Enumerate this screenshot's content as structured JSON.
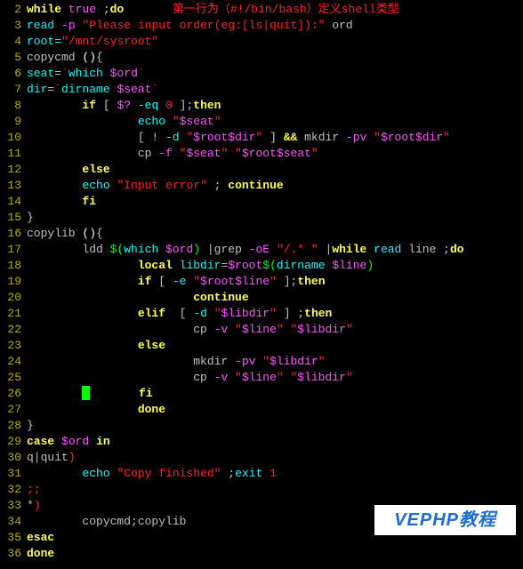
{
  "gutter_start": 2,
  "gutter_end": 36,
  "cursor_line": 26,
  "lines": [
    {
      "n": 2,
      "segs": [
        {
          "cls": "c-yellow",
          "t": "while "
        },
        {
          "cls": "c-magenta",
          "t": "true"
        },
        {
          "cls": "c-base",
          "t": " ;"
        },
        {
          "cls": "c-yellow",
          "t": "do"
        },
        {
          "cls": "c-red",
          "t": "       第一行为（#!/bin/bash）定义shell类型"
        }
      ]
    },
    {
      "n": 3,
      "segs": [
        {
          "cls": "c-cyan",
          "t": "read"
        },
        {
          "cls": "c-magenta",
          "t": " -p "
        },
        {
          "cls": "c-red",
          "t": "\"Please input order(eg:[ls|quit]):\""
        },
        {
          "cls": "c-base",
          "t": " ord"
        }
      ]
    },
    {
      "n": 4,
      "segs": [
        {
          "cls": "c-cyan",
          "t": "root="
        },
        {
          "cls": "c-red",
          "t": "\"/mnt/sysroot\""
        }
      ]
    },
    {
      "n": 5,
      "segs": [
        {
          "cls": "c-base",
          "t": "copycmd "
        },
        {
          "cls": "c-white",
          "t": "()"
        },
        {
          "cls": "c-base",
          "t": "{"
        }
      ]
    },
    {
      "n": 6,
      "segs": [
        {
          "cls": "c-cyan",
          "t": "seat"
        },
        {
          "cls": "c-base",
          "t": "="
        },
        {
          "cls": "c-red",
          "t": "`"
        },
        {
          "cls": "c-cyan",
          "t": "which"
        },
        {
          "cls": "c-red",
          "t": " "
        },
        {
          "cls": "c-magenta",
          "t": "$ord"
        },
        {
          "cls": "c-red",
          "t": "`"
        }
      ]
    },
    {
      "n": 7,
      "segs": [
        {
          "cls": "c-cyan",
          "t": "dir"
        },
        {
          "cls": "c-base",
          "t": "="
        },
        {
          "cls": "c-red",
          "t": "`"
        },
        {
          "cls": "c-cyan",
          "t": "dirname"
        },
        {
          "cls": "c-red",
          "t": " "
        },
        {
          "cls": "c-magenta",
          "t": "$seat"
        },
        {
          "cls": "c-red",
          "t": "`"
        }
      ]
    },
    {
      "n": 8,
      "segs": [
        {
          "cls": "c-base",
          "t": "        "
        },
        {
          "cls": "c-yellow",
          "t": "if"
        },
        {
          "cls": "c-base",
          "t": " [ "
        },
        {
          "cls": "c-magenta",
          "t": "$?"
        },
        {
          "cls": "c-cyan",
          "t": " -eq "
        },
        {
          "cls": "c-red",
          "t": "0"
        },
        {
          "cls": "c-base",
          "t": " ];"
        },
        {
          "cls": "c-yellow",
          "t": "then"
        }
      ]
    },
    {
      "n": 9,
      "segs": [
        {
          "cls": "c-base",
          "t": "                "
        },
        {
          "cls": "c-cyan",
          "t": "echo"
        },
        {
          "cls": "c-base",
          "t": " "
        },
        {
          "cls": "c-red",
          "t": "\""
        },
        {
          "cls": "c-magenta",
          "t": "$seat"
        },
        {
          "cls": "c-red",
          "t": "\""
        }
      ]
    },
    {
      "n": 10,
      "segs": [
        {
          "cls": "c-base",
          "t": "                [ ! "
        },
        {
          "cls": "c-cyan",
          "t": "-d"
        },
        {
          "cls": "c-base",
          "t": " "
        },
        {
          "cls": "c-red",
          "t": "\""
        },
        {
          "cls": "c-magenta",
          "t": "$root$dir"
        },
        {
          "cls": "c-red",
          "t": "\""
        },
        {
          "cls": "c-base",
          "t": " ] "
        },
        {
          "cls": "c-yellow",
          "t": "&&"
        },
        {
          "cls": "c-base",
          "t": " mkdir "
        },
        {
          "cls": "c-magenta",
          "t": "-pv "
        },
        {
          "cls": "c-red",
          "t": "\""
        },
        {
          "cls": "c-magenta",
          "t": "$root$dir"
        },
        {
          "cls": "c-red",
          "t": "\""
        }
      ]
    },
    {
      "n": 11,
      "segs": [
        {
          "cls": "c-base",
          "t": "                cp "
        },
        {
          "cls": "c-magenta",
          "t": "-f "
        },
        {
          "cls": "c-red",
          "t": "\""
        },
        {
          "cls": "c-magenta",
          "t": "$seat"
        },
        {
          "cls": "c-red",
          "t": "\" \""
        },
        {
          "cls": "c-magenta",
          "t": "$root$seat"
        },
        {
          "cls": "c-red",
          "t": "\""
        }
      ]
    },
    {
      "n": 12,
      "segs": [
        {
          "cls": "c-base",
          "t": "        "
        },
        {
          "cls": "c-yellow",
          "t": "else"
        }
      ]
    },
    {
      "n": 13,
      "segs": [
        {
          "cls": "c-base",
          "t": "        "
        },
        {
          "cls": "c-cyan",
          "t": "echo"
        },
        {
          "cls": "c-base",
          "t": " "
        },
        {
          "cls": "c-red",
          "t": "\"Input error\""
        },
        {
          "cls": "c-base",
          "t": " ; "
        },
        {
          "cls": "c-yellow",
          "t": "continue"
        }
      ]
    },
    {
      "n": 14,
      "segs": [
        {
          "cls": "c-base",
          "t": "        "
        },
        {
          "cls": "c-yellow",
          "t": "fi"
        }
      ]
    },
    {
      "n": 15,
      "segs": [
        {
          "cls": "c-base",
          "t": "}"
        }
      ]
    },
    {
      "n": 16,
      "segs": [
        {
          "cls": "c-base",
          "t": "copylib "
        },
        {
          "cls": "c-white",
          "t": "()"
        },
        {
          "cls": "c-base",
          "t": "{"
        }
      ]
    },
    {
      "n": 17,
      "segs": [
        {
          "cls": "c-base",
          "t": "        ldd "
        },
        {
          "cls": "c-lime",
          "t": "$("
        },
        {
          "cls": "c-cyan",
          "t": "which "
        },
        {
          "cls": "c-magenta",
          "t": "$ord"
        },
        {
          "cls": "c-lime",
          "t": ")"
        },
        {
          "cls": "c-base",
          "t": " |grep "
        },
        {
          "cls": "c-magenta",
          "t": "-oE "
        },
        {
          "cls": "c-red",
          "t": "\"/.* \""
        },
        {
          "cls": "c-base",
          "t": " |"
        },
        {
          "cls": "c-yellow",
          "t": "while"
        },
        {
          "cls": "c-base",
          "t": " "
        },
        {
          "cls": "c-cyan",
          "t": "read"
        },
        {
          "cls": "c-base",
          "t": " line ;"
        },
        {
          "cls": "c-yellow",
          "t": "do"
        }
      ]
    },
    {
      "n": 18,
      "segs": [
        {
          "cls": "c-base",
          "t": "                "
        },
        {
          "cls": "c-yellow",
          "t": "local"
        },
        {
          "cls": "c-base",
          "t": " "
        },
        {
          "cls": "c-cyan",
          "t": "libdir"
        },
        {
          "cls": "c-base",
          "t": "="
        },
        {
          "cls": "c-magenta",
          "t": "$root"
        },
        {
          "cls": "c-lime",
          "t": "$("
        },
        {
          "cls": "c-cyan",
          "t": "dirname "
        },
        {
          "cls": "c-magenta",
          "t": "$line"
        },
        {
          "cls": "c-lime",
          "t": ")"
        }
      ]
    },
    {
      "n": 19,
      "segs": [
        {
          "cls": "c-base",
          "t": "                "
        },
        {
          "cls": "c-yellow",
          "t": "if"
        },
        {
          "cls": "c-base",
          "t": " [ "
        },
        {
          "cls": "c-cyan",
          "t": "-e"
        },
        {
          "cls": "c-base",
          "t": " "
        },
        {
          "cls": "c-red",
          "t": "\""
        },
        {
          "cls": "c-magenta",
          "t": "$root$line"
        },
        {
          "cls": "c-red",
          "t": "\""
        },
        {
          "cls": "c-base",
          "t": " ];"
        },
        {
          "cls": "c-yellow",
          "t": "then"
        }
      ]
    },
    {
      "n": 20,
      "segs": [
        {
          "cls": "c-base",
          "t": "                        "
        },
        {
          "cls": "c-yellow",
          "t": "continue"
        }
      ]
    },
    {
      "n": 21,
      "segs": [
        {
          "cls": "c-base",
          "t": "                "
        },
        {
          "cls": "c-yellow",
          "t": "elif"
        },
        {
          "cls": "c-base",
          "t": "  [ "
        },
        {
          "cls": "c-cyan",
          "t": "-d"
        },
        {
          "cls": "c-base",
          "t": " "
        },
        {
          "cls": "c-red",
          "t": "\""
        },
        {
          "cls": "c-magenta",
          "t": "$libdir"
        },
        {
          "cls": "c-red",
          "t": "\""
        },
        {
          "cls": "c-base",
          "t": " ] ;"
        },
        {
          "cls": "c-yellow",
          "t": "then"
        }
      ]
    },
    {
      "n": 22,
      "segs": [
        {
          "cls": "c-base",
          "t": "                        cp "
        },
        {
          "cls": "c-magenta",
          "t": "-v "
        },
        {
          "cls": "c-red",
          "t": "\""
        },
        {
          "cls": "c-magenta",
          "t": "$line"
        },
        {
          "cls": "c-red",
          "t": "\" \""
        },
        {
          "cls": "c-magenta",
          "t": "$libdir"
        },
        {
          "cls": "c-red",
          "t": "\""
        }
      ]
    },
    {
      "n": 23,
      "segs": [
        {
          "cls": "c-base",
          "t": "                "
        },
        {
          "cls": "c-yellow",
          "t": "else"
        }
      ]
    },
    {
      "n": 24,
      "segs": [
        {
          "cls": "c-base",
          "t": "                        mkdir "
        },
        {
          "cls": "c-magenta",
          "t": "-pv "
        },
        {
          "cls": "c-red",
          "t": "\""
        },
        {
          "cls": "c-magenta",
          "t": "$libdir"
        },
        {
          "cls": "c-red",
          "t": "\""
        }
      ]
    },
    {
      "n": 25,
      "segs": [
        {
          "cls": "c-base",
          "t": "                        cp "
        },
        {
          "cls": "c-magenta",
          "t": "-v "
        },
        {
          "cls": "c-red",
          "t": "\""
        },
        {
          "cls": "c-magenta",
          "t": "$line"
        },
        {
          "cls": "c-red",
          "t": "\" \""
        },
        {
          "cls": "c-magenta",
          "t": "$libdir"
        },
        {
          "cls": "c-red",
          "t": "\""
        }
      ]
    },
    {
      "n": 26,
      "segs": [
        {
          "cls": "c-base",
          "t": "                "
        },
        {
          "cls": "c-yellow",
          "t": "fi"
        }
      ]
    },
    {
      "n": 27,
      "segs": [
        {
          "cls": "c-base",
          "t": "                "
        },
        {
          "cls": "c-yellow",
          "t": "done"
        }
      ]
    },
    {
      "n": 28,
      "segs": [
        {
          "cls": "c-base",
          "t": "}"
        }
      ]
    },
    {
      "n": 29,
      "segs": [
        {
          "cls": "c-yellow",
          "t": "case"
        },
        {
          "cls": "c-base",
          "t": " "
        },
        {
          "cls": "c-magenta",
          "t": "$ord"
        },
        {
          "cls": "c-base",
          "t": " "
        },
        {
          "cls": "c-yellow",
          "t": "in"
        }
      ]
    },
    {
      "n": 30,
      "segs": [
        {
          "cls": "c-base",
          "t": "q|quit"
        },
        {
          "cls": "c-red",
          "t": ")"
        }
      ]
    },
    {
      "n": 31,
      "segs": [
        {
          "cls": "c-base",
          "t": "        "
        },
        {
          "cls": "c-cyan",
          "t": "echo"
        },
        {
          "cls": "c-base",
          "t": " "
        },
        {
          "cls": "c-red",
          "t": "\"Copy finished\""
        },
        {
          "cls": "c-base",
          "t": " ;"
        },
        {
          "cls": "c-cyan",
          "t": "exit"
        },
        {
          "cls": "c-base",
          "t": " "
        },
        {
          "cls": "c-red",
          "t": "1"
        }
      ]
    },
    {
      "n": 32,
      "segs": [
        {
          "cls": "c-red",
          "t": ";;"
        }
      ]
    },
    {
      "n": 33,
      "segs": [
        {
          "cls": "c-base",
          "t": "*"
        },
        {
          "cls": "c-red",
          "t": ")"
        }
      ]
    },
    {
      "n": 34,
      "segs": [
        {
          "cls": "c-base",
          "t": "        copycmd;copylib"
        }
      ]
    },
    {
      "n": 35,
      "segs": [
        {
          "cls": "c-yellow",
          "t": "esac"
        }
      ]
    },
    {
      "n": 36,
      "segs": [
        {
          "cls": "c-yellow",
          "t": "done"
        }
      ]
    }
  ],
  "watermark": "VEPHP教程"
}
